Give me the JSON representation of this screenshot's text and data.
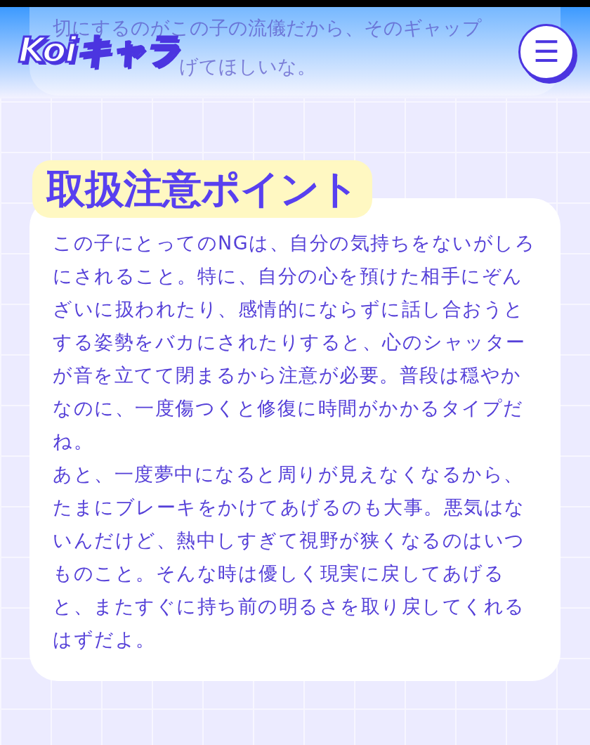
{
  "header": {
    "logo": "Koiキャラ",
    "menu_icon": "☰"
  },
  "previous_text": {
    "line_1": "切にするのがこの子の流儀だから、そのギャップ",
    "line_2": "げてほしいな。"
  },
  "section": {
    "title": "取扱注意ポイント",
    "paragraphs": [
      "この子にとってのNGは、自分の気持ちをないがしろにされること。特に、自分の心を預けた相手にぞんざいに扱われたり、感情的にならずに話し合おうとする姿勢をバカにされたりすると、心のシャッターが音を立てて閉まるから注意が必要。普段は穏やかなのに、一度傷つくと修復に時間がかかるタイプだね。",
      "あと、一度夢中になると周りが見えなくなるから、たまにブレーキをかけてあげるのも大事。悪気はないんだけど、熱中しすぎて視野が狭くなるのはいつものこと。そんな時は優しく現実に戻してあげると、またすぐに持ち前の明るさを取り戻してくれるはずだよ。"
    ]
  }
}
